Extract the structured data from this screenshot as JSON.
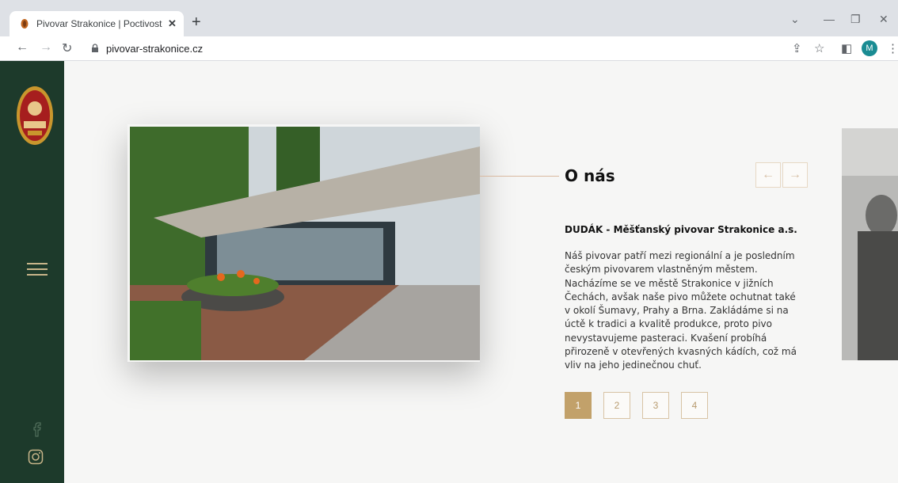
{
  "browser": {
    "tab_title": "Pivovar Strakonice | Poctivost v t",
    "url": "pivovar-strakonice.cz",
    "profile_initial": "M"
  },
  "site": {
    "heading": "O nás",
    "subheading": "DUDÁK - Měšťanský pivovar Strakonice a.s.",
    "paragraph": "Náš pivovar patří mezi regionální a je posledním českým pivovarem vlastněným městem. Nacházíme se ve městě Strakonice v jižních Čechách, avšak naše pivo můžete ochutnat také v okolí Šumavy, Prahy a Brna. Zakládáme si na úctě k tradici a kvalitě produkce, proto pivo nevystavujeme pasteraci. Kvašení probíhá přirozeně v otevřených kvasných kádích, což má vliv na jeho jedinečnou chuť.",
    "pages": [
      "1",
      "2",
      "3",
      "4"
    ],
    "active_page": "1",
    "colors": {
      "sidebar": "#1d3a2b",
      "accent": "#c2a16a"
    }
  }
}
